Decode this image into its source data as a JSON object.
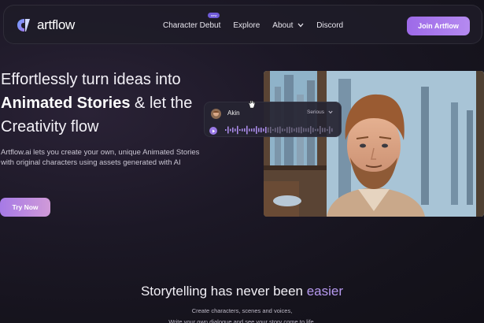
{
  "navbar": {
    "logo_text": "artflow",
    "links": [
      {
        "label": "Character Debut",
        "badge": "new"
      },
      {
        "label": "Explore"
      },
      {
        "label": "About"
      },
      {
        "label": "Discord"
      }
    ],
    "cta_label": "Join Artflow"
  },
  "hero": {
    "title_line1": "Effortlessly turn ideas into",
    "title_bold": "Animated Stories",
    "title_line2_rest": " & let the",
    "title_line3": "Creativity flow",
    "subtitle": "Artflow.ai lets you create your own, unique Animated Stories with original characters using assets generated with AI",
    "button_label": "Try Now",
    "voice_card": {
      "name": "Akin",
      "tone": "Serious"
    }
  },
  "section": {
    "title_main": "Storytelling has never been ",
    "title_accent": "easier",
    "line1": "Create characters, scenes and voices,",
    "line2": "Write your own dialogue and see your story come to life."
  },
  "colors": {
    "accent": "#b79af0",
    "button_gradient_start": "#9d6ae8",
    "background": "#1c1826"
  },
  "icons": [
    "artflow-logo-icon",
    "chevron-down-icon",
    "play-icon",
    "waveform-icon",
    "hand-cursor-icon"
  ]
}
